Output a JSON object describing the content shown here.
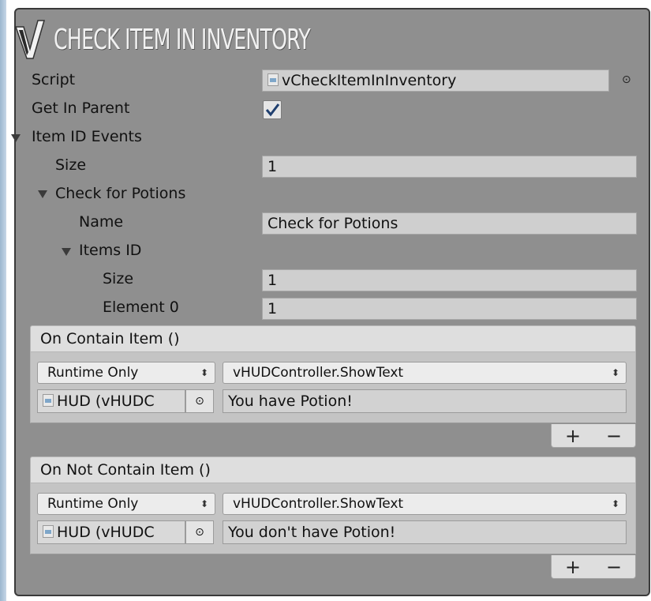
{
  "header": {
    "title": "CHECK ITEM IN INVENTORY"
  },
  "fields": {
    "script_label": "Script",
    "script_value": "vCheckItemInInventory",
    "get_in_parent_label": "Get In Parent",
    "get_in_parent_checked": true,
    "item_id_events_label": "Item ID Events",
    "size_label": "Size",
    "size_value": "1",
    "check_potions_label": "Check for Potions",
    "name_label": "Name",
    "name_value": "Check for Potions",
    "items_id_label": "Items ID",
    "items_size_label": "Size",
    "items_size_value": "1",
    "element0_label": "Element 0",
    "element0_value": "1"
  },
  "events": [
    {
      "header": "On Contain Item ()",
      "mode": "Runtime Only",
      "function": "vHUDController.ShowText",
      "object": "HUD (vHUDC",
      "argument": "You have Potion!",
      "plus": "+",
      "minus": "−"
    },
    {
      "header": "On Not Contain Item ()",
      "mode": "Runtime Only",
      "function": "vHUDController.ShowText",
      "object": "HUD (vHUDC",
      "argument": "You don't have Potion!",
      "plus": "+",
      "minus": "−"
    }
  ],
  "icons": {
    "logo": "v-check-logo-icon",
    "script_file": "script-file-icon",
    "target": "object-picker-icon",
    "dropdown_arrow": "updown-arrow-icon"
  },
  "colors": {
    "panel_bg": "#8f8f8f",
    "title": "#f1f1f1",
    "checkmark": "#1f3f6f"
  }
}
